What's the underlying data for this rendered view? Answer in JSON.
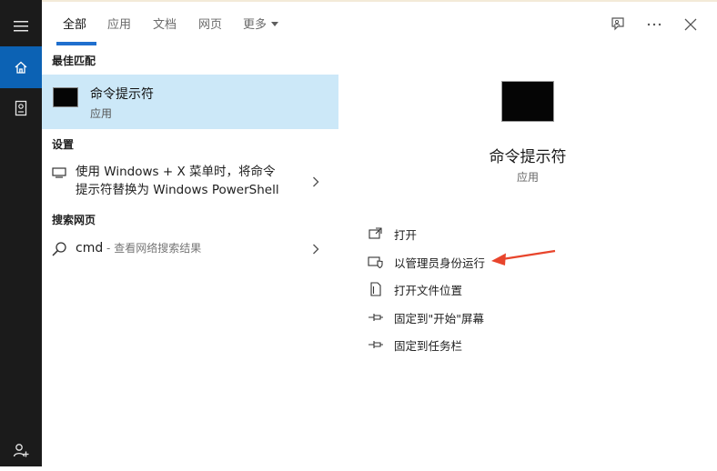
{
  "tabs": {
    "all": "全部",
    "apps": "应用",
    "docs": "文档",
    "web": "网页",
    "more": "更多"
  },
  "sections": {
    "best_match": "最佳匹配",
    "settings": "设置",
    "web_search": "搜索网页"
  },
  "best_match": {
    "title": "命令提示符",
    "subtitle": "应用"
  },
  "settings_item": {
    "line1": "使用 Windows + X 菜单时，将命令",
    "line2": "提示符替换为 Windows PowerShell"
  },
  "web_item": {
    "query": "cmd",
    "hint": " - 查看网络搜索结果"
  },
  "preview": {
    "title": "命令提示符",
    "subtitle": "应用"
  },
  "actions": [
    {
      "label": "打开",
      "icon": "open-icon"
    },
    {
      "label": "以管理员身份运行",
      "icon": "shield-admin-icon"
    },
    {
      "label": "打开文件位置",
      "icon": "file-location-icon"
    },
    {
      "label": "固定到\"开始\"屏幕",
      "icon": "pin-icon"
    },
    {
      "label": "固定到任务栏",
      "icon": "pin-icon"
    }
  ],
  "colors": {
    "rail_bg": "#1b1b1b",
    "rail_active": "#0c62b4",
    "highlight": "#cce8f8",
    "accent": "#1f6fce",
    "annotation_arrow": "#e8452c"
  }
}
